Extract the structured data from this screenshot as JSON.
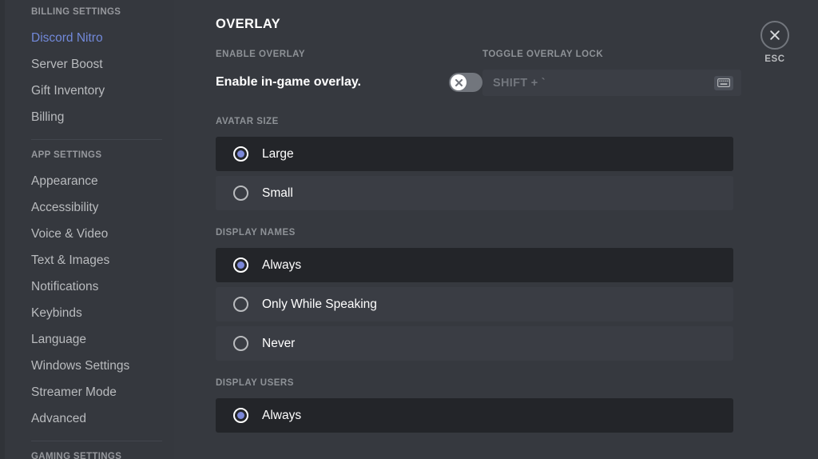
{
  "sidebar": {
    "sections": [
      {
        "header": "BILLING SETTINGS",
        "items": [
          {
            "label": "Discord Nitro",
            "active": true
          },
          {
            "label": "Server Boost",
            "active": false
          },
          {
            "label": "Gift Inventory",
            "active": false
          },
          {
            "label": "Billing",
            "active": false
          }
        ]
      },
      {
        "header": "APP SETTINGS",
        "items": [
          {
            "label": "Appearance",
            "active": false
          },
          {
            "label": "Accessibility",
            "active": false
          },
          {
            "label": "Voice & Video",
            "active": false
          },
          {
            "label": "Text & Images",
            "active": false
          },
          {
            "label": "Notifications",
            "active": false
          },
          {
            "label": "Keybinds",
            "active": false
          },
          {
            "label": "Language",
            "active": false
          },
          {
            "label": "Windows Settings",
            "active": false
          },
          {
            "label": "Streamer Mode",
            "active": false
          },
          {
            "label": "Advanced",
            "active": false
          }
        ]
      },
      {
        "header": "GAMING SETTINGS",
        "items": []
      }
    ],
    "active_color": "#7289da"
  },
  "main": {
    "page_title": "OVERLAY",
    "enable_overlay": {
      "label": "ENABLE OVERLAY",
      "description": "Enable in-game overlay.",
      "toggle_state": "off",
      "toggle_icon": "close-x-icon"
    },
    "toggle_overlay_lock": {
      "label": "TOGGLE OVERLAY LOCK",
      "value": "SHIFT + `",
      "icon": "keyboard-icon"
    },
    "avatar_size": {
      "label": "AVATAR SIZE",
      "options": [
        {
          "label": "Large",
          "selected": true
        },
        {
          "label": "Small",
          "selected": false
        }
      ]
    },
    "display_names": {
      "label": "DISPLAY NAMES",
      "options": [
        {
          "label": "Always",
          "selected": true
        },
        {
          "label": "Only While Speaking",
          "selected": false
        },
        {
          "label": "Never",
          "selected": false
        }
      ]
    },
    "display_users": {
      "label": "DISPLAY USERS",
      "options": [
        {
          "label": "Always",
          "selected": true
        }
      ]
    }
  },
  "close": {
    "icon": "close-x-icon",
    "label": "ESC"
  },
  "colors": {
    "background": "#36393f",
    "sidebar": "#35383e",
    "row": "#3a3d44",
    "row_selected": "#232529",
    "accent": "#7289da",
    "radio_fill": "#7b87d8",
    "text_primary": "#ffffff",
    "text_muted": "#b9bbbe",
    "label_muted": "#8e9297"
  }
}
